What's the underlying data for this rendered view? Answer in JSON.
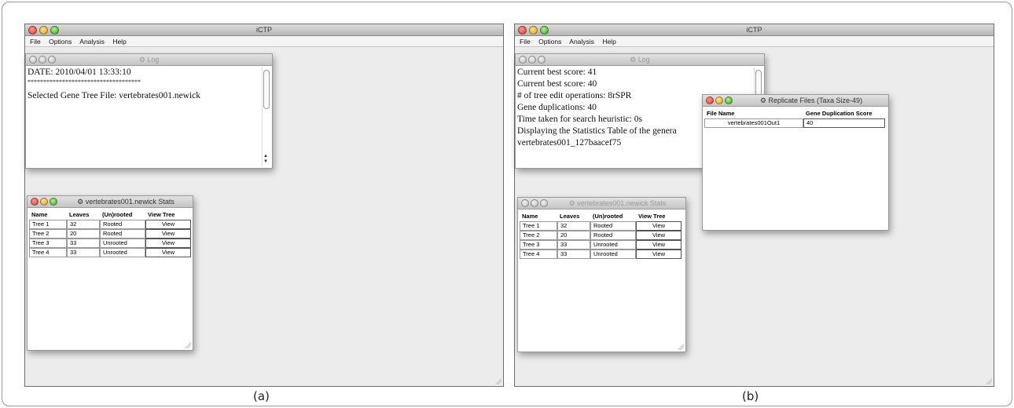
{
  "app_title": "iCTP",
  "menu": [
    "File",
    "Options",
    "Analysis",
    "Help"
  ],
  "log_title": "Log",
  "panel_a": {
    "log_lines": [
      "DATE: 2010/04/01 13:33:10",
      "************************************",
      "",
      "Selected Gene Tree File: vertebrates001.newick"
    ],
    "stats_title": "vertebrates001.newick Stats",
    "caption": "(a)"
  },
  "panel_b": {
    "log_lines": [
      "Current best score: 41",
      "Current best score: 40",
      "# of tree edit operations: 8rSPR",
      "Gene duplications: 40",
      "Time taken for search heuristic: 0s",
      "Displaying the Statistics Table of the genera",
      "vertebrates001_127baacef75"
    ],
    "stats_title": "vertebrates001.newick Stats",
    "replicate": {
      "title": "Replicate Files (Taxa Size-49)",
      "headers": [
        "File Name",
        "Gene Duplication Score"
      ],
      "rows": [
        [
          "vertebrates001Out1",
          "40"
        ]
      ]
    },
    "caption": "(b)"
  },
  "stats_headers": [
    "Name",
    "Leaves",
    "(Un)rooted",
    "View Tree"
  ],
  "stats_rows": [
    [
      "Tree 1",
      "32",
      "Rooted",
      "View"
    ],
    [
      "Tree 2",
      "20",
      "Rooted",
      "View"
    ],
    [
      "Tree 3",
      "33",
      "Unrooted",
      "View"
    ],
    [
      "Tree 4",
      "33",
      "Unrooted",
      "View"
    ]
  ]
}
